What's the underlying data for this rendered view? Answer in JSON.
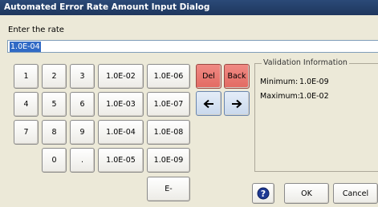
{
  "dialog": {
    "title": "Automated Error Rate Amount Input Dialog",
    "prompt": "Enter the rate"
  },
  "input": {
    "value": "1.0E-04"
  },
  "keypad": {
    "row1": [
      "1",
      "2",
      "3",
      "1.0E-02",
      "1.0E-06"
    ],
    "row2": [
      "4",
      "5",
      "6",
      "1.0E-03",
      "1.0E-07"
    ],
    "row3": [
      "7",
      "8",
      "9",
      "1.0E-04",
      "1.0E-08"
    ],
    "row4": [
      "0",
      ".",
      "1.0E-05",
      "1.0E-09"
    ],
    "exp": "E-"
  },
  "actions": {
    "del": "Del",
    "back": "Back",
    "ok": "OK",
    "cancel": "Cancel"
  },
  "validation": {
    "title": "Validation Information",
    "min_label": "Minimum:",
    "min_value": "1.0E-09",
    "max_label": "Maximum:",
    "max_value": "1.0E-02"
  },
  "colors": {
    "title_bg": "#1e365d",
    "delete_red": "#e26a62",
    "selection": "#316ac5"
  }
}
